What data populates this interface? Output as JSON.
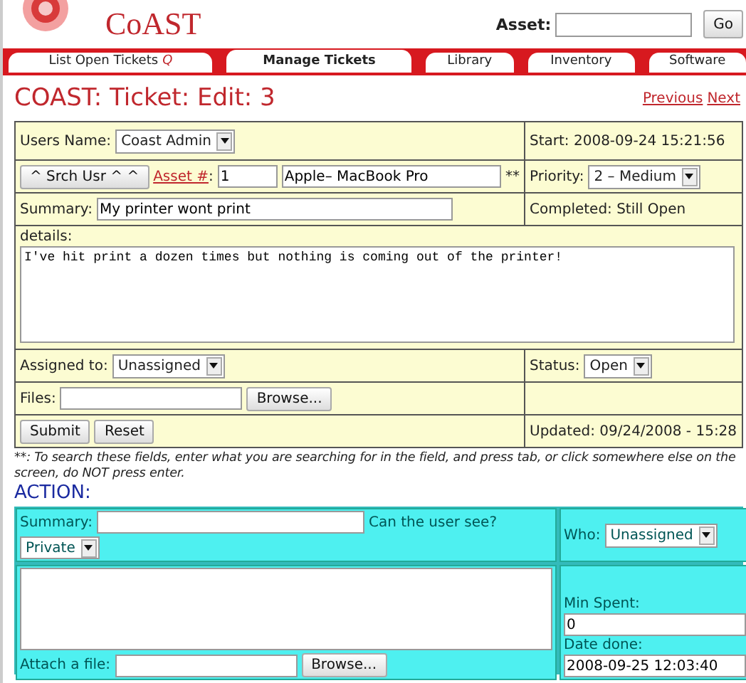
{
  "header": {
    "logo_text": "CoAST",
    "asset_label": "Asset:",
    "go_button": "Go"
  },
  "tabs": [
    {
      "label": "List Open Tickets",
      "suffix": "Q",
      "selected": false
    },
    {
      "label": "Manage Tickets",
      "selected": true
    },
    {
      "label": "Library",
      "selected": false
    },
    {
      "label": "Inventory",
      "selected": false
    },
    {
      "label": "Software",
      "selected": false
    }
  ],
  "page_title": "COAST: Ticket: Edit: 3",
  "nav_links": [
    "Previous",
    "Next"
  ],
  "form": {
    "users_name_label": "Users Name:",
    "users_name": "Coast Admin",
    "start": "Start: 2008-09-24 15:21:56",
    "search_user_button": "^ Srch Usr ^ ^",
    "asset_link": "Asset #",
    "asset_sep": ":",
    "asset_number": "1",
    "asset_name": "Apple– MacBook Pro",
    "asset_mark": "**",
    "priority_label": "Priority:",
    "priority": "2 – Medium",
    "summary_label": "Summary:",
    "summary": "My printer wont print",
    "completed": "Completed: Still Open",
    "details_label": "details:",
    "details": "I've hit print a dozen times but nothing is coming out of the printer!",
    "assigned_label": "Assigned to:",
    "assigned": "Unassigned",
    "status_label": "Status:",
    "status": "Open",
    "files_label": "Files:",
    "browse_button": "Browse...",
    "submit_button": "Submit",
    "reset_button": "Reset",
    "updated": "Updated: 09/24/2008 - 15:28"
  },
  "note": "**: To search these fields, enter what you are searching for in the field, and press tab, or click somewhere else on the screen, do NOT press enter.",
  "action": {
    "heading": "ACTION:",
    "summary_label": "Summary:",
    "visibility_label": "Can the user see?",
    "visibility": "Private",
    "who_label": "Who:",
    "who": "Unassigned",
    "attach_label": "Attach a file:",
    "browse_button": "Browse...",
    "min_spent_label": "Min Spent:",
    "min_spent": "0",
    "date_done_label": "Date done:",
    "date_done": "2008-09-25 12:03:40"
  }
}
